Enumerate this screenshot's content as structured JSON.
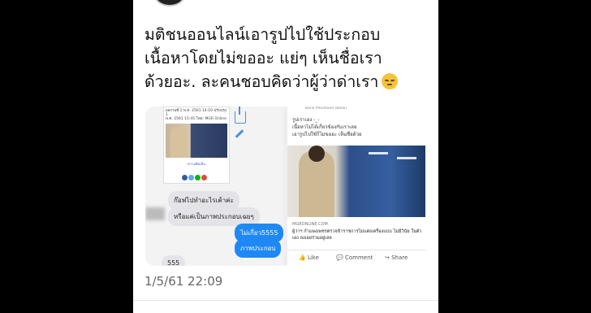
{
  "tweet": {
    "lines": [
      "มติชนออนไลน์เอารูปไปใช้ประกอบ",
      "เนื้อหาโดยไม่ขออะ แย่ๆ เห็นชื่อเรา",
      "ด้วยอะ. ละคนชอบคิดว่าผู้ว่าด่าเรา"
    ],
    "emoji": "pensive-face-emoji",
    "timestamp": "1/5/61 22:09"
  },
  "left_shot": {
    "meta_line1": "ผลงานพี่ 1 พ.ค. 2561 14:10 ปรับปรุง 1",
    "meta_line2": "พ.ค. 2561 15:45   โดย: MGR Online",
    "share_label": "ความคิดเห็น",
    "bubbles_left": [
      "ก๊อฟไปทำอะไรเค้าค่ะ",
      "หรือแค่เป็นภาพประกอบเฉยๆ",
      "555"
    ],
    "bubbles_right": [
      "ไม่เกี่ยว5555",
      "ภาพประกอบ"
    ]
  },
  "right_shot": {
    "header": "Bank Phoohood (Bank)",
    "caption_lines": [
      "รูปเราเอง -_-",
      "เนื้อหาไม่ได้เกี่ยวข้องกับเราเลย",
      "เอารูปไปใช้ก็ไม่ขออะ เห็นชื่อด้วย"
    ],
    "source": "MGRONLINE.COM",
    "headline": "ผู้ว่าฯ กำแพงเพชรตรวจข้าราชการไม่แต่งเครื่องแบบ ไม่มีวินัย ในตัวเอง ลงเอยร่วมอยู่เลย",
    "actions": [
      "Like",
      "Comment",
      "Share"
    ]
  },
  "colors": {
    "background": "#000000",
    "card": "#ffffff",
    "bubble_sent": "#1e88f5",
    "bubble_received": "#e4e4e8",
    "link": "#3a5bbf"
  }
}
